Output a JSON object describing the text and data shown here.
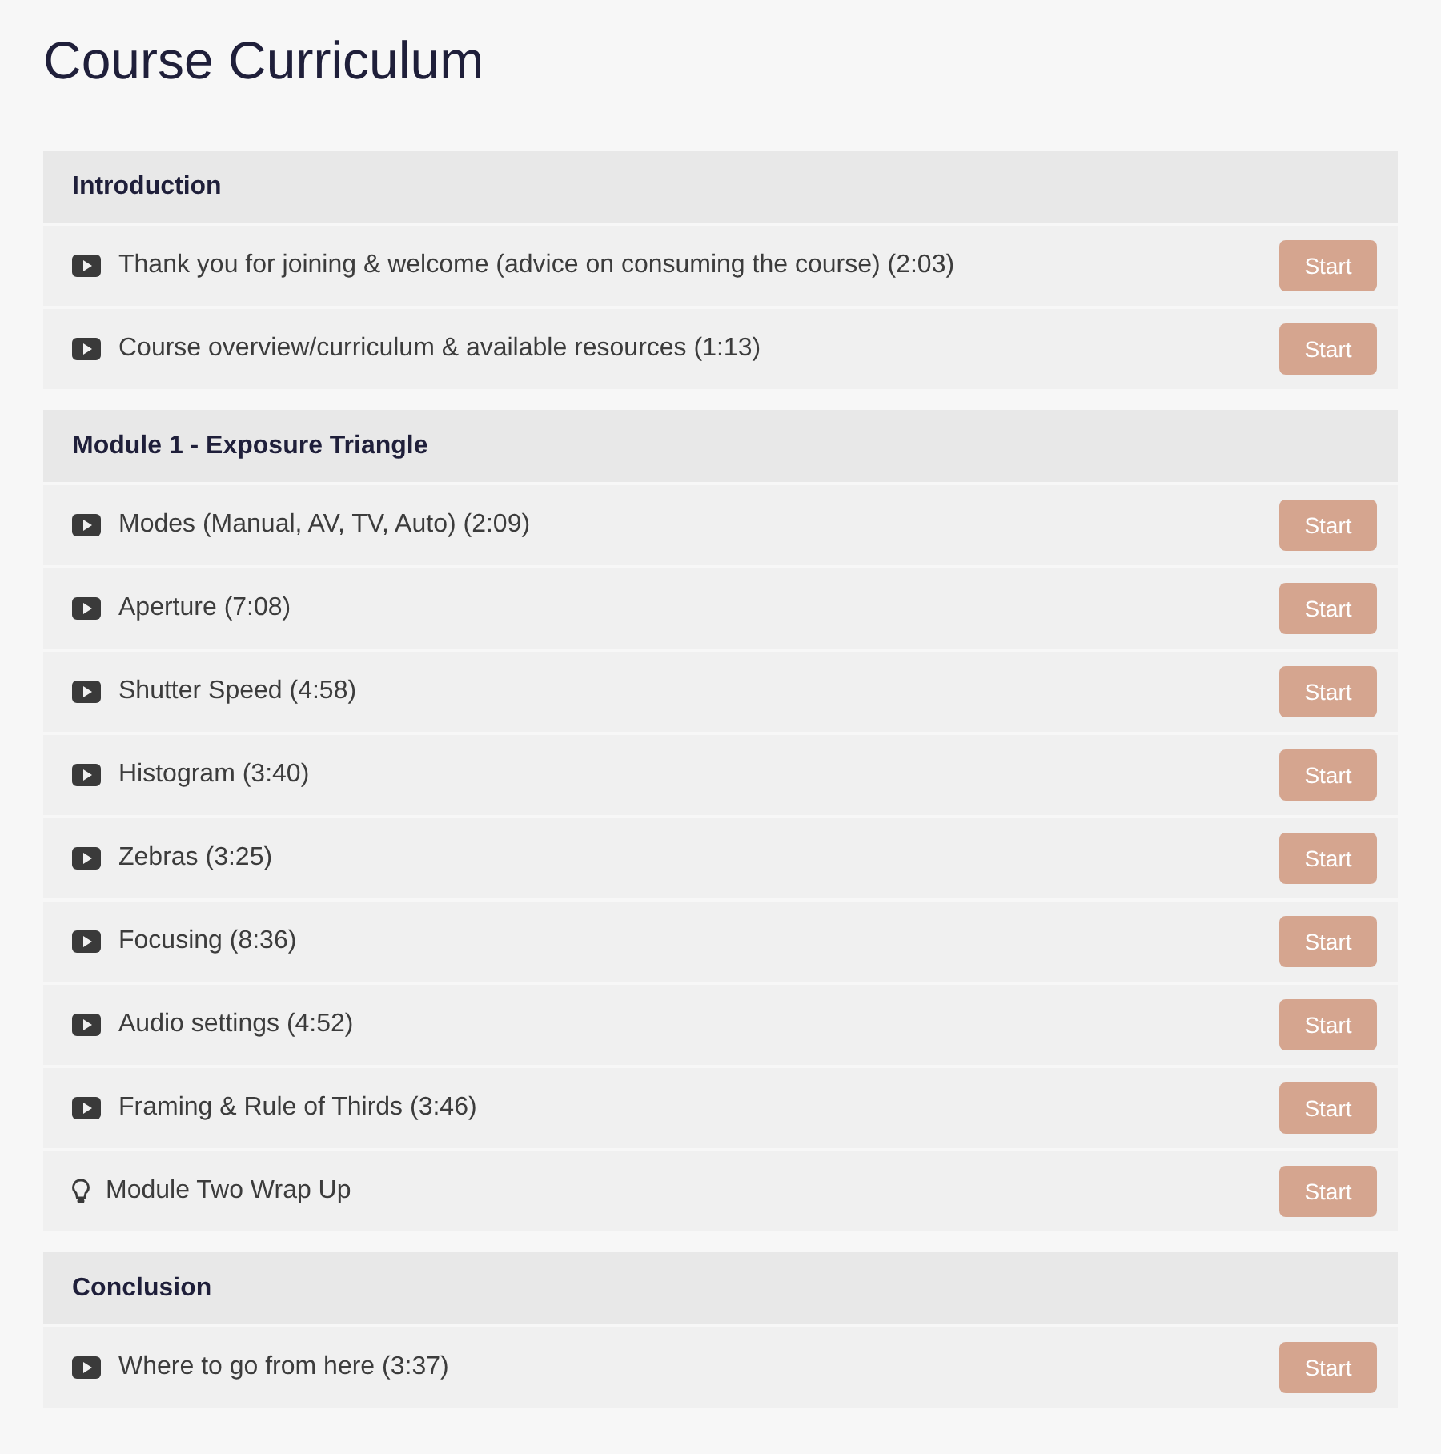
{
  "title": "Course Curriculum",
  "sections": [
    {
      "title": "Introduction",
      "lessons": [
        {
          "kind": "video",
          "title": "Thank you for joining & welcome (advice on consuming the course) (2:03)",
          "button": "Start"
        },
        {
          "kind": "video",
          "title": "Course overview/curriculum & available resources (1:13)",
          "button": "Start"
        }
      ]
    },
    {
      "title": "Module 1 - Exposure Triangle",
      "lessons": [
        {
          "kind": "video",
          "title": "Modes (Manual, AV, TV, Auto) (2:09)",
          "button": "Start"
        },
        {
          "kind": "video",
          "title": "Aperture (7:08)",
          "button": "Start"
        },
        {
          "kind": "video",
          "title": "Shutter Speed (4:58)",
          "button": "Start"
        },
        {
          "kind": "video",
          "title": "Histogram (3:40)",
          "button": "Start"
        },
        {
          "kind": "video",
          "title": "Zebras (3:25)",
          "button": "Start"
        },
        {
          "kind": "video",
          "title": "Focusing (8:36)",
          "button": "Start"
        },
        {
          "kind": "video",
          "title": "Audio settings (4:52)",
          "button": "Start"
        },
        {
          "kind": "video",
          "title": "Framing & Rule of Thirds (3:46)",
          "button": "Start"
        },
        {
          "kind": "tip",
          "title": "Module Two Wrap Up",
          "button": "Start"
        }
      ]
    },
    {
      "title": "Conclusion",
      "lessons": [
        {
          "kind": "video",
          "title": "Where to go from here (3:37)",
          "button": "Start"
        }
      ]
    }
  ]
}
